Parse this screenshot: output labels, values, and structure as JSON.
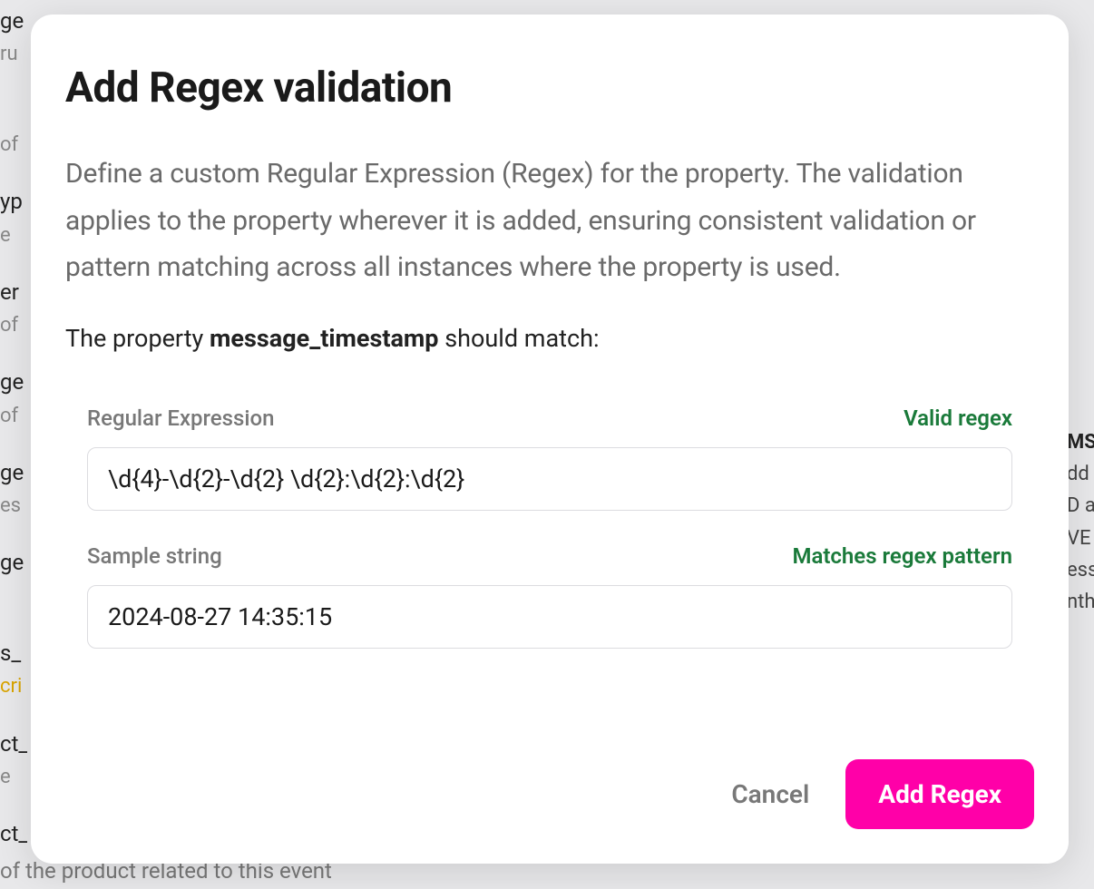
{
  "background": {
    "left": [
      {
        "main": "ge",
        "sub": "ru"
      },
      {
        "main": " ",
        "sub": "of"
      },
      {
        "main": "yp",
        "sub": "e"
      },
      {
        "main": "er",
        "sub": "of"
      },
      {
        "main": "ge",
        "sub": "of"
      },
      {
        "main": "ge",
        "sub": "es"
      },
      {
        "main": "ge",
        "sub": ""
      },
      {
        "main": "s_",
        "sub": "cri"
      },
      {
        "main": "ct_",
        "sub": "e"
      },
      {
        "main": "ct_",
        "sub": ""
      }
    ],
    "right": [
      "MS",
      "dd",
      "D a",
      "VE",
      "ess",
      "nth"
    ],
    "bottom": "of the product related to this event"
  },
  "modal": {
    "title": "Add Regex validation",
    "description": "Define a custom Regular Expression (Regex) for the property. The validation applies to the property wherever it is added, ensuring consistent validation or pattern matching across all instances where the property is used.",
    "propertyPrefix": "The property ",
    "propertyName": "message_timestamp",
    "propertySuffix": " should match:",
    "regexField": {
      "label": "Regular Expression",
      "status": "Valid regex",
      "value": "\\d{4}-\\d{2}-\\d{2} \\d{2}:\\d{2}:\\d{2}"
    },
    "sampleField": {
      "label": "Sample string",
      "status": "Matches regex pattern",
      "value": "2024-08-27 14:35:15"
    },
    "actions": {
      "cancel": "Cancel",
      "submit": "Add Regex"
    }
  }
}
